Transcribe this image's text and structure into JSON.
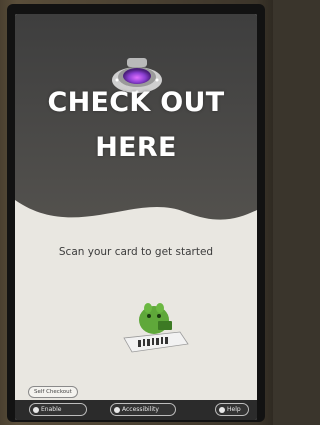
{
  "screen": {
    "headline_line1": "CHECK OUT",
    "headline_line2": "HERE",
    "prompt": "Scan your card to get started"
  },
  "chip": {
    "label": "Self Checkout"
  },
  "bottom_bar": {
    "buttons": [
      {
        "label": "Enable",
        "icon": "globe-icon"
      },
      {
        "label": "Accessibility",
        "icon": "accessibility-icon"
      },
      {
        "label": "Help",
        "icon": "help-icon"
      }
    ]
  },
  "colors": {
    "accent": "#8a3fd1",
    "screen_dark": "#444444",
    "screen_light": "#e9e7e1",
    "mascot_green": "#5fa83a"
  }
}
